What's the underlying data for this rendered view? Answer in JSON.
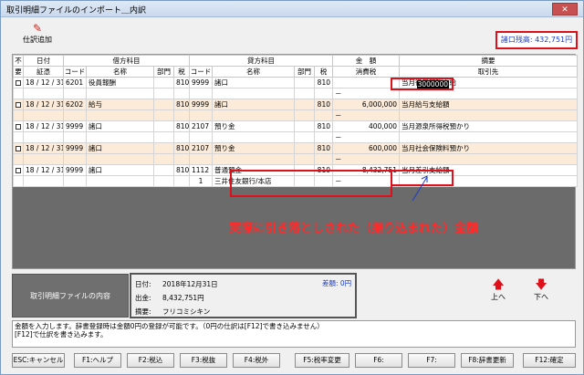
{
  "window": {
    "title": "取引明細ファイルのインポート＿内訳",
    "close": "✕"
  },
  "toolbar": {
    "add_label": "仕訳追加"
  },
  "balance": "諸口残高: 432,751円",
  "headers": {
    "h1": [
      "不",
      "日付",
      "借方科目",
      "貸方科目",
      "金　額",
      "摘要"
    ],
    "h2": [
      "要",
      "証憑",
      "コード",
      "名称",
      "部門",
      "税",
      "コード",
      "名称",
      "部門",
      "税",
      "消費税",
      "取引先"
    ]
  },
  "rows": [
    {
      "date": "18 / 12 / 31",
      "dcode": "6201",
      "dname": "役員報酬",
      "dtax": "810",
      "ccode": "9999",
      "cname": "諸口",
      "ctax": "810",
      "amount": "3000000",
      "memo": "当月役員報酬支給",
      "sub_dash": "－",
      "alt": false
    },
    {
      "date": "18 / 12 / 31",
      "dcode": "6202",
      "dname": "給与",
      "dtax": "810",
      "ccode": "9999",
      "cname": "諸口",
      "ctax": "810",
      "amount": "6,000,000",
      "memo": "当月給与支給額",
      "sub_dash": "－",
      "alt": true
    },
    {
      "date": "18 / 12 / 31",
      "dcode": "9999",
      "dname": "諸口",
      "dtax": "810",
      "ccode": "2107",
      "cname": "預り金",
      "ctax": "810",
      "amount": "400,000",
      "memo": "当月源泉所得税預かり",
      "sub_dash": "－",
      "alt": false
    },
    {
      "date": "18 / 12 / 31",
      "dcode": "9999",
      "dname": "諸口",
      "dtax": "810",
      "ccode": "2107",
      "cname": "預り金",
      "ctax": "810",
      "amount": "600,000",
      "memo": "当月社会保険料預かり",
      "sub_dash": "－",
      "alt": true
    },
    {
      "date": "18 / 12 / 31",
      "dcode": "9999",
      "dname": "諸口",
      "dtax": "810",
      "ccode": "1112",
      "cname": "普通預金",
      "ctax": "810",
      "amount": "8,432,751",
      "memo": "当月差引支給額",
      "sub_code": "1",
      "sub_name": "三井住友銀行/本店",
      "sub_dash": "－",
      "alt": false
    }
  ],
  "annotation": "実際に引き落としされた（振り込まれた）金額",
  "panel": {
    "button": "取引明細ファイルの内容",
    "date_label": "日付:",
    "date_value": "2018年12月31日",
    "diff": "差額: 0円",
    "amount_label": "出金:",
    "amount_value": "8,432,751円",
    "memo_label": "摘要:",
    "memo_value": "フリコミシキン"
  },
  "nav": {
    "up": "上へ",
    "down": "下へ"
  },
  "message": [
    "金額を入力します。辞書登録時は金額0円の登録が可能です。（0円の仕訳は[F12]で書き込みません）",
    "[F12]で仕訳を書き込みます。"
  ],
  "fkeys": [
    "ESC:キャンセル",
    "F1:ヘルプ",
    "F2:税込",
    "F3:税抜",
    "F4:税外",
    "F5:税率変更",
    "F6:",
    "F7:",
    "F8:辞書更新",
    "F12:確定"
  ]
}
